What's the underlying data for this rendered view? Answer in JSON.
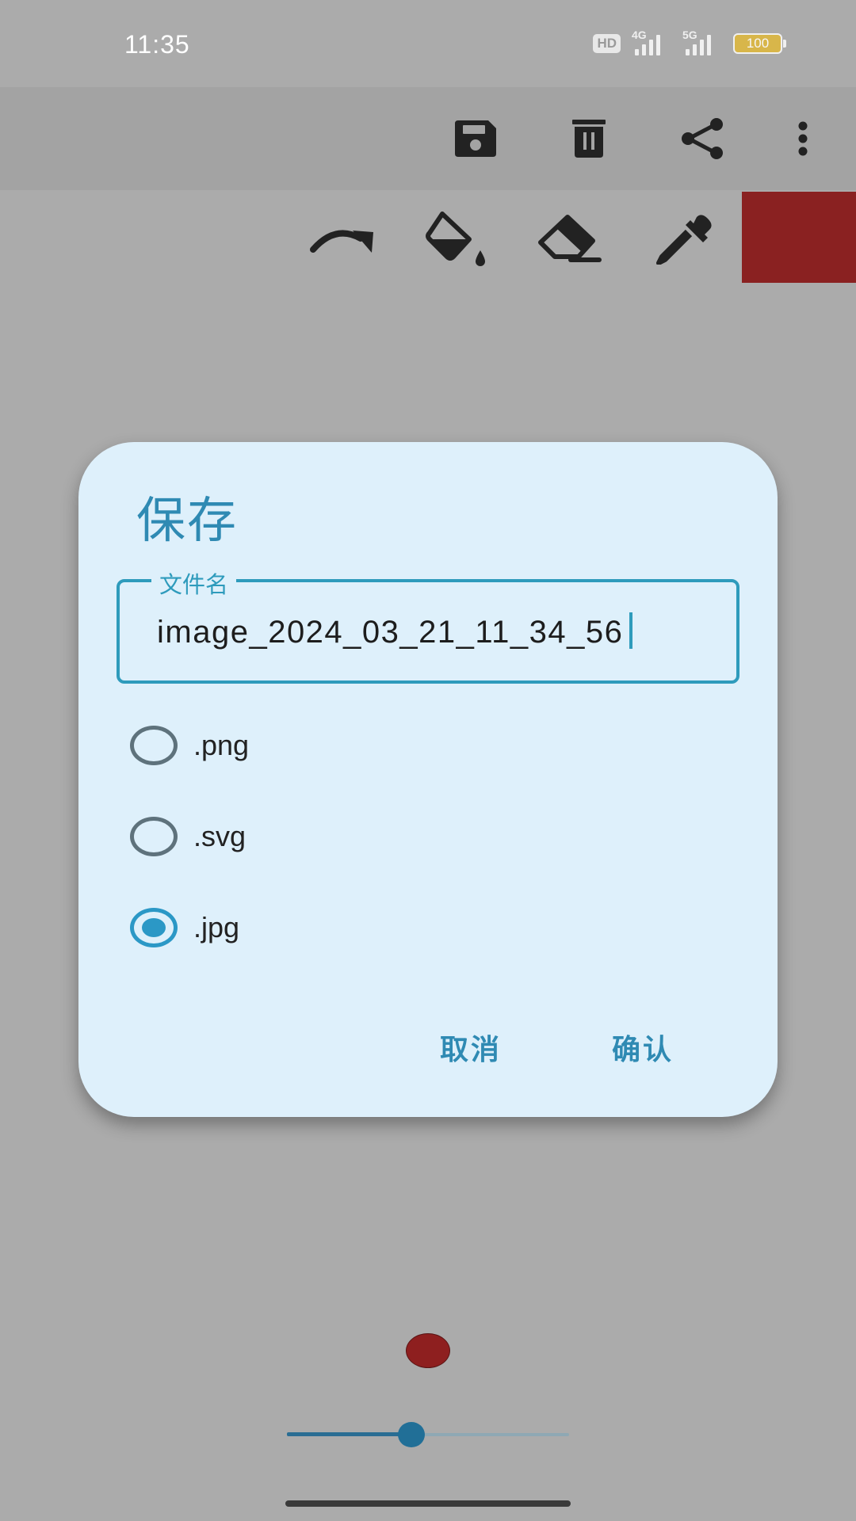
{
  "status_bar": {
    "time": "11:35",
    "hd": "HD",
    "network_1": "4G",
    "network_2": "5G",
    "battery": "100"
  },
  "top_toolbar": {
    "icons": [
      "save-icon",
      "delete-icon",
      "share-icon",
      "more-vert-icon"
    ]
  },
  "tool_row": {
    "icons": [
      "redo-icon",
      "fill-bucket-icon",
      "eraser-icon",
      "eyedropper-icon"
    ],
    "current_color": "#8a2121"
  },
  "dialog": {
    "title": "保存",
    "filename_label": "文件名",
    "filename_value": "image_2024_03_21_11_34_56",
    "formats": [
      {
        "label": ".png",
        "selected": false
      },
      {
        "label": ".svg",
        "selected": false
      },
      {
        "label": ".jpg",
        "selected": true
      }
    ],
    "cancel_label": "取消",
    "confirm_label": "确认"
  },
  "brush": {
    "color": "#8e1f1f",
    "size_fraction": 0.44
  }
}
